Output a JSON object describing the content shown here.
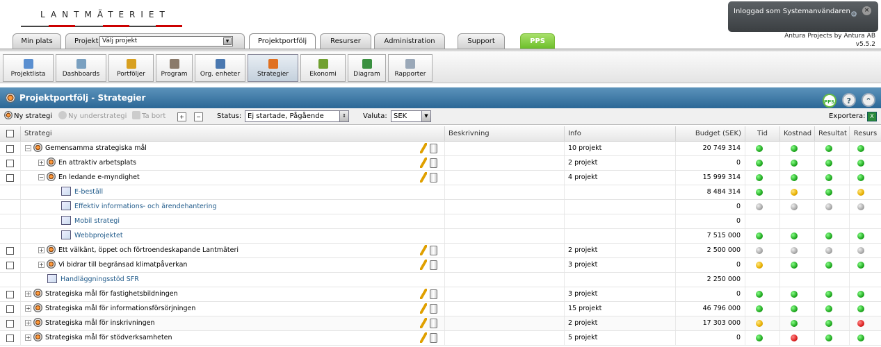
{
  "logo": {
    "text": "LANTMÄTERIET"
  },
  "login": {
    "text": "Inloggad som Systemanvändaren",
    "close": "×"
  },
  "version": {
    "line1": "Antura Projects by Antura AB",
    "line2": "v5.5.2"
  },
  "tabs": {
    "min_plats": "Min plats",
    "projekt": "Projekt",
    "projekt_select": "Välj projekt",
    "projektportfolj": "Projektportfölj",
    "resurser": "Resurser",
    "administration": "Administration",
    "support": "Support",
    "pps": "PPS"
  },
  "toolbar": [
    {
      "label": "Projektlista",
      "color": "#5a8fd0"
    },
    {
      "label": "Dashboards",
      "color": "#7aa0c0"
    },
    {
      "label": "Portföljer",
      "color": "#d8a020"
    },
    {
      "label": "Program",
      "color": "#8a7a6a"
    },
    {
      "label": "Org. enheter",
      "color": "#4a78b0"
    },
    {
      "label": "Strategier",
      "color": "#e07020"
    },
    {
      "label": "Ekonomi",
      "color": "#70a030"
    },
    {
      "label": "Diagram",
      "color": "#3a9040"
    },
    {
      "label": "Rapporter",
      "color": "#9aa8b8"
    }
  ],
  "title": "Projektportfölj - Strategier",
  "actions": {
    "ny_strategi": "Ny strategi",
    "ny_understrategi": "Ny understrategi",
    "ta_bort": "Ta bort",
    "status_label": "Status:",
    "status_value": "Ej startade, Pågående",
    "valuta_label": "Valuta:",
    "valuta_value": "SEK",
    "exportera": "Exportera:"
  },
  "columns": {
    "strategi": "Strategi",
    "beskrivning": "Beskrivning",
    "info": "Info",
    "budget": "Budget (SEK)",
    "tid": "Tid",
    "kostnad": "Kostnad",
    "resultat": "Resultat",
    "resurs": "Resurs"
  },
  "rows": [
    {
      "name": "Gemensamma strategiska mål",
      "info": "10 projekt",
      "budget": "20 749 314",
      "tid": "g",
      "kostnad": "g",
      "resultat": "g",
      "resurs": "g"
    },
    {
      "name": "En attraktiv arbetsplats",
      "info": "2 projekt",
      "budget": "0",
      "tid": "g",
      "kostnad": "g",
      "resultat": "g",
      "resurs": "g"
    },
    {
      "name": "En ledande e-myndighet",
      "info": "4 projekt",
      "budget": "15 999 314",
      "tid": "g",
      "kostnad": "g",
      "resultat": "g",
      "resurs": "g"
    },
    {
      "name": "E-beställ",
      "info": "",
      "budget": "8 484 314",
      "tid": "g",
      "kostnad": "y",
      "resultat": "g",
      "resurs": "y"
    },
    {
      "name": "Effektiv informations- och ärendehantering",
      "info": "",
      "budget": "0",
      "tid": "gr",
      "kostnad": "gr",
      "resultat": "gr",
      "resurs": "gr"
    },
    {
      "name": "Mobil strategi",
      "info": "",
      "budget": "0",
      "tid": "",
      "kostnad": "",
      "resultat": "",
      "resurs": ""
    },
    {
      "name": "Webbprojektet",
      "info": "",
      "budget": "7 515 000",
      "tid": "g",
      "kostnad": "g",
      "resultat": "g",
      "resurs": "g"
    },
    {
      "name": "Ett välkänt, öppet och förtroendeskapande Lantmäteri",
      "info": "2 projekt",
      "budget": "2 500 000",
      "tid": "gr",
      "kostnad": "gr",
      "resultat": "gr",
      "resurs": "gr"
    },
    {
      "name": "Vi bidrar till begränsad klimatpåverkan",
      "info": "3 projekt",
      "budget": "0",
      "tid": "y",
      "kostnad": "g",
      "resultat": "g",
      "resurs": "g"
    },
    {
      "name": "Handläggningsstöd SFR",
      "info": "",
      "budget": "2 250 000",
      "tid": "",
      "kostnad": "",
      "resultat": "",
      "resurs": ""
    },
    {
      "name": "Strategiska mål för fastighetsbildningen",
      "info": "3 projekt",
      "budget": "0",
      "tid": "g",
      "kostnad": "g",
      "resultat": "g",
      "resurs": "g"
    },
    {
      "name": "Strategiska mål för informationsförsörjningen",
      "info": "15 projekt",
      "budget": "46 796 000",
      "tid": "g",
      "kostnad": "g",
      "resultat": "g",
      "resurs": "g"
    },
    {
      "name": "Strategiska mål för inskrivningen",
      "info": "2 projekt",
      "budget": "17 303 000",
      "tid": "y",
      "kostnad": "g",
      "resultat": "g",
      "resurs": "r"
    },
    {
      "name": "Strategiska mål för stödverksamheten",
      "info": "5 projekt",
      "budget": "0",
      "tid": "g",
      "kostnad": "r",
      "resultat": "g",
      "resurs": "g"
    }
  ]
}
